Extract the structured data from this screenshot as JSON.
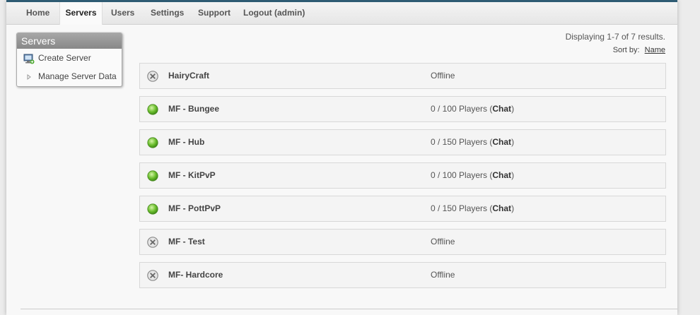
{
  "nav": {
    "home": "Home",
    "servers": "Servers",
    "users": "Users",
    "settings": "Settings",
    "support": "Support",
    "logout": "Logout (admin)"
  },
  "sidebar": {
    "title": "Servers",
    "items": [
      {
        "label": "Create Server",
        "icon": "monitor-add-icon"
      },
      {
        "label": "Manage Server Data",
        "icon": "triangle-right-icon"
      }
    ]
  },
  "results": {
    "summary": "Displaying 1-7 of 7 results.",
    "sort_label": "Sort by:",
    "sort_value": "Name"
  },
  "servers": [
    {
      "name": "HairyCraft",
      "status": "offline",
      "text": "Offline"
    },
    {
      "name": "MF - Bungee",
      "status": "online",
      "players": "0 / 100 Players",
      "chat": "Chat"
    },
    {
      "name": "MF - Hub",
      "status": "online",
      "players": "0 / 150 Players",
      "chat": "Chat"
    },
    {
      "name": "MF - KitPvP",
      "status": "online",
      "players": "0 / 100 Players",
      "chat": "Chat"
    },
    {
      "name": "MF - PottPvP",
      "status": "online",
      "players": "0 / 150 Players",
      "chat": "Chat"
    },
    {
      "name": "MF - Test",
      "status": "offline",
      "text": "Offline"
    },
    {
      "name": "MF- Hardcore",
      "status": "offline",
      "text": "Offline"
    }
  ],
  "colors": {
    "online": "#6cbf2e",
    "offline": "#8a8a8a",
    "topbar": "#2e5b73"
  }
}
